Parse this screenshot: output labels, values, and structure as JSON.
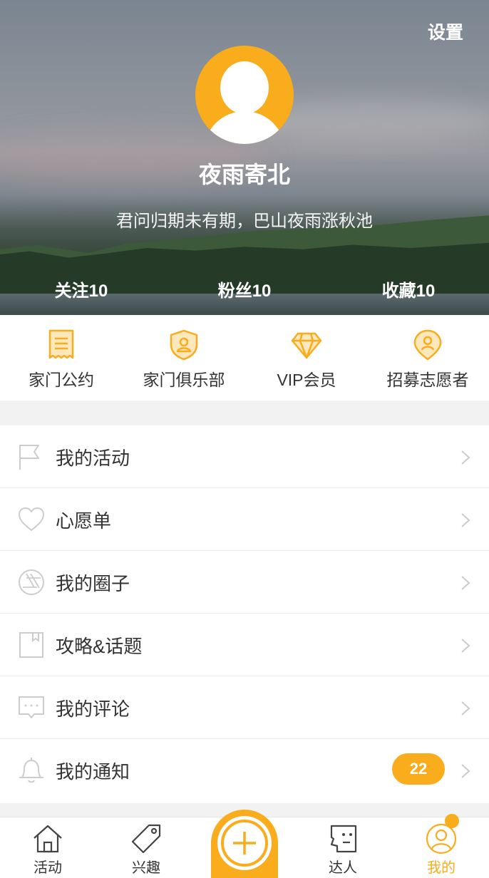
{
  "header": {
    "settings_label": "设置",
    "username": "夜雨寄北",
    "motto": "君问归期未有期，巴山夜雨涨秋池",
    "stats": [
      {
        "label": "关注10"
      },
      {
        "label": "粉丝10"
      },
      {
        "label": "收藏10"
      }
    ]
  },
  "shortcuts": [
    {
      "label": "家门公约",
      "icon": "receipt-icon"
    },
    {
      "label": "家门俱乐部",
      "icon": "shield-user-icon"
    },
    {
      "label": "VIP会员",
      "icon": "diamond-icon"
    },
    {
      "label": "招募志愿者",
      "icon": "location-user-icon"
    }
  ],
  "menu": [
    {
      "label": "我的活动",
      "icon": "flag-icon"
    },
    {
      "label": "心愿单",
      "icon": "heart-icon"
    },
    {
      "label": "我的圈子",
      "icon": "aperture-icon"
    },
    {
      "label": "攻略&话题",
      "icon": "book-icon"
    },
    {
      "label": "我的评论",
      "icon": "comment-icon"
    },
    {
      "label": "我的通知",
      "icon": "bell-icon",
      "badge": "22"
    }
  ],
  "tabbar": [
    {
      "label": "活动",
      "icon": "home-icon"
    },
    {
      "label": "兴趣",
      "icon": "tag-icon"
    },
    {
      "label": "",
      "icon": "plus-icon"
    },
    {
      "label": "达人",
      "icon": "face-icon"
    },
    {
      "label": "我的",
      "icon": "user-circle-icon",
      "active": true
    }
  ],
  "colors": {
    "accent": "#f9ac1c",
    "text": "#333333",
    "icon_gray": "#cccccc",
    "divider": "#ececec"
  }
}
